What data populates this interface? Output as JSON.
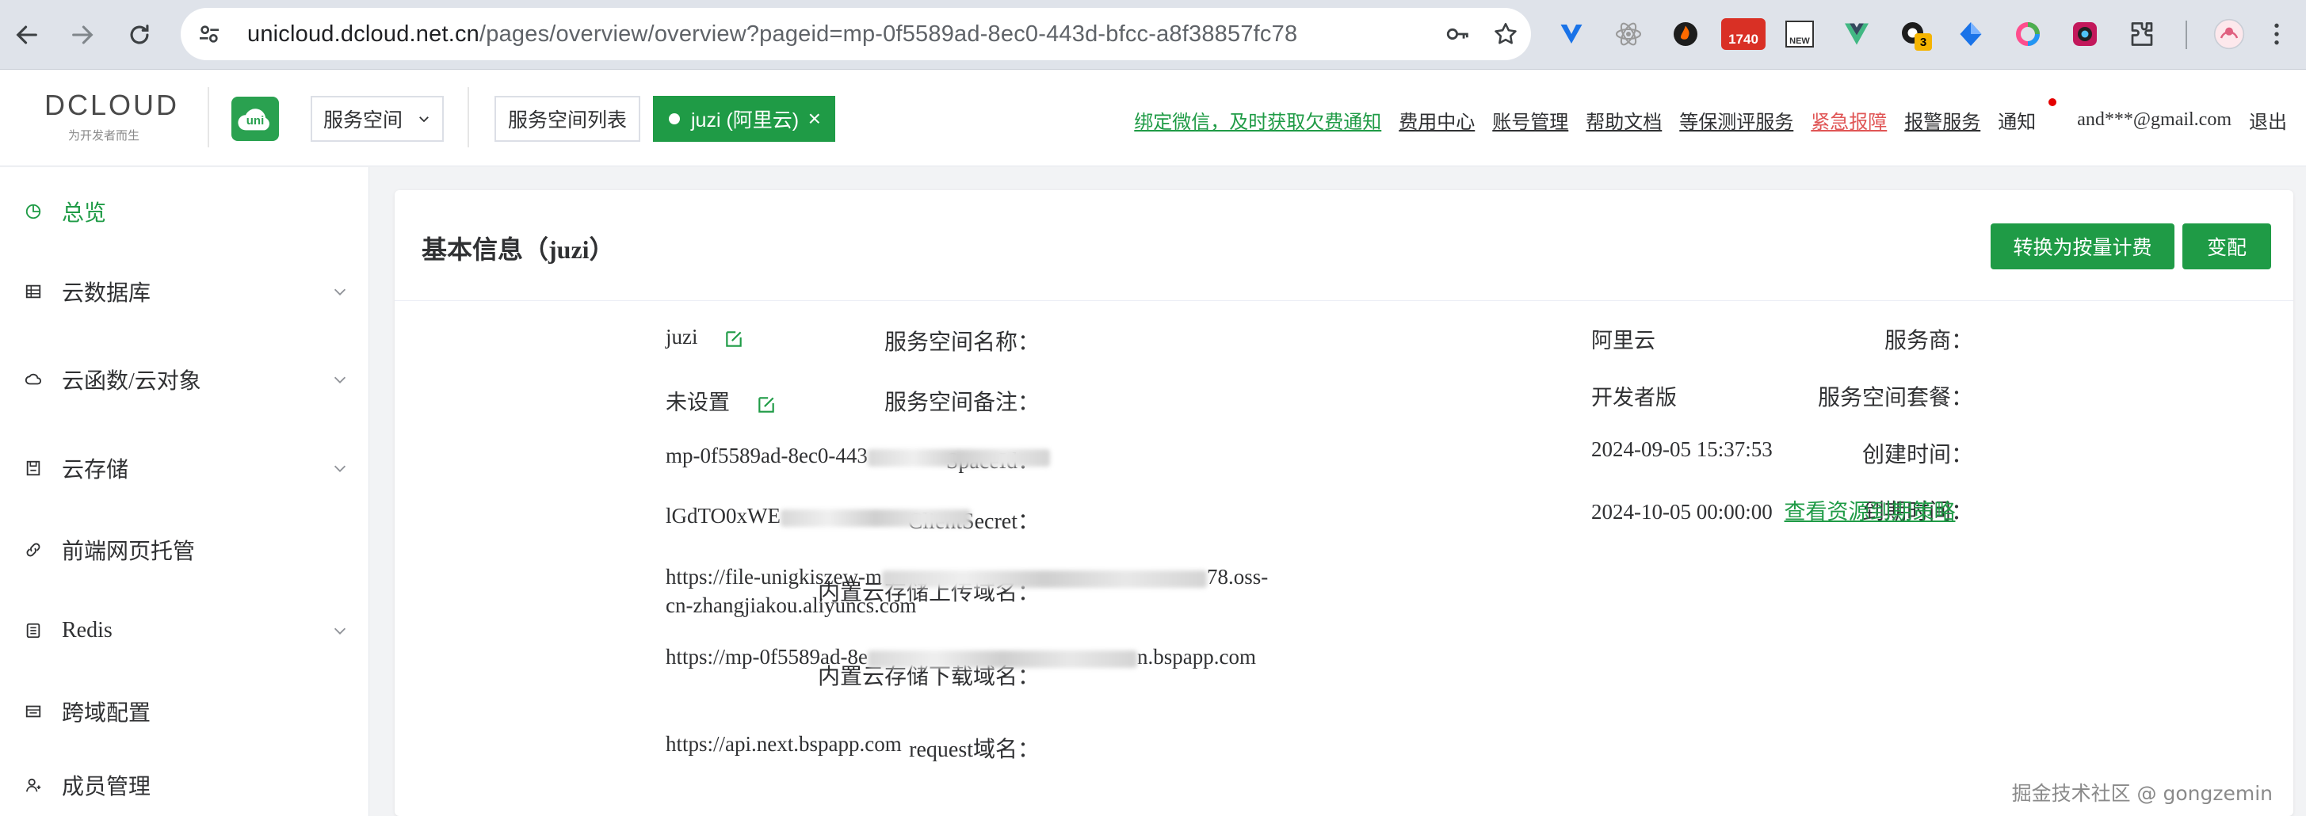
{
  "browser": {
    "url_host": "unicloud.dcloud.net.cn",
    "url_path": "/pages/overview/overview?pageid=mp-0f5589ad-8ec0-443d-bfcc-a8f38857fc78",
    "ext_badge_1740": "1740",
    "ext_badge_new": "NEW",
    "ext_badge_3": "3"
  },
  "header": {
    "logo_text": "DCLOUD",
    "logo_sub": "为开发者而生",
    "uni_badge": "uni",
    "space_select": "服务空间",
    "space_list_btn": "服务空间列表",
    "space_tag": "juzi (阿里云)",
    "space_tag_close": "×",
    "links": {
      "wechat": "绑定微信，及时获取欠费通知",
      "billing": "费用中心",
      "account": "账号管理",
      "docs": "帮助文档",
      "mlps": "等保测评服务",
      "report": "紧急报障",
      "alarm": "报警服务",
      "notify": "通知",
      "email": "and***@gmail.com",
      "logout": "退出"
    }
  },
  "sidebar": {
    "items": [
      {
        "label": "总览"
      },
      {
        "label": "云数据库"
      },
      {
        "label": "云函数/云对象"
      },
      {
        "label": "云存储"
      },
      {
        "label": "前端网页托管"
      },
      {
        "label": "Redis"
      },
      {
        "label": "跨域配置"
      },
      {
        "label": "成员管理"
      }
    ]
  },
  "card": {
    "title": "基本信息（juzi）",
    "btn_switch": "转换为按量计费",
    "btn_change": "变配",
    "left": [
      {
        "label": "服务空间名称：",
        "value": "juzi"
      },
      {
        "label": "服务空间备注：",
        "value": "未设置"
      },
      {
        "label": "SpaceId：",
        "value": "mp-0f5589ad-8ec0-443"
      },
      {
        "label": "ClientSecret：",
        "value": "lGdTO0xWE"
      },
      {
        "label": "内置云存储上传域名：",
        "value_a": "https://file-unigkiszew-m",
        "value_b": "78.oss-",
        "value_c": "cn-zhangjiakou.aliyuncs.com"
      },
      {
        "label": "内置云存储下载域名：",
        "value_a": "https://mp-0f5589ad-8e",
        "value_b": "n.bspapp.com"
      },
      {
        "label": "request域名：",
        "value": "https://api.next.bspapp.com"
      }
    ],
    "right": [
      {
        "label": "服务商：",
        "value": "阿里云"
      },
      {
        "label": "服务空间套餐：",
        "value": "开发者版"
      },
      {
        "label": "创建时间：",
        "value": "2024-09-05 15:37:53"
      },
      {
        "label": "到期时间：",
        "value": "2024-10-05 00:00:00",
        "link": "查看资源到期策略"
      }
    ]
  },
  "watermark": "掘金技术社区 @ gongzemin",
  "colors": {
    "brand_green": "#1f9b46",
    "danger_red": "#e05555"
  }
}
